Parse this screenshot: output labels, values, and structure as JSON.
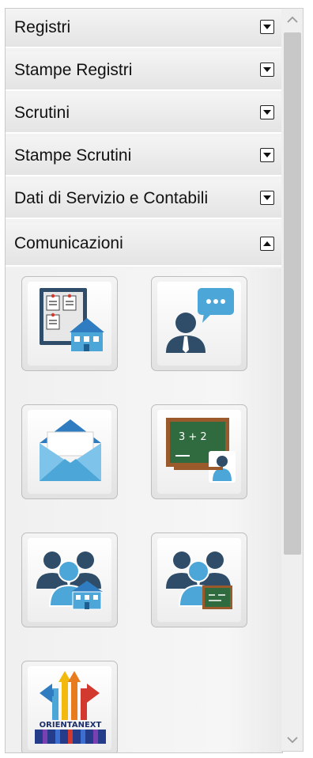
{
  "accordion": {
    "sections": [
      {
        "label": "Registri",
        "state": "collapsed"
      },
      {
        "label": "Stampe Registri",
        "state": "collapsed"
      },
      {
        "label": "Scrutini",
        "state": "collapsed"
      },
      {
        "label": "Stampe Scrutini",
        "state": "collapsed"
      },
      {
        "label": "Dati di Servizio e Contabili",
        "state": "collapsed"
      },
      {
        "label": "Comunicazioni",
        "state": "expanded"
      }
    ]
  },
  "tiles": [
    {
      "icon": "bulletin-board-school-icon"
    },
    {
      "icon": "person-chat-icon"
    },
    {
      "icon": "envelope-icon"
    },
    {
      "icon": "chalkboard-teacher-icon"
    },
    {
      "icon": "group-school-icon"
    },
    {
      "icon": "group-chalkboard-icon"
    },
    {
      "icon": "orientanext-logo-icon",
      "logo_text": "ORIENTANEXT"
    }
  ],
  "colors": {
    "icon_blue": "#4da6d8",
    "icon_dark": "#2f4d68",
    "chalkboard_green": "#2f6b3f",
    "chalkboard_frame": "#9b5a2c"
  }
}
